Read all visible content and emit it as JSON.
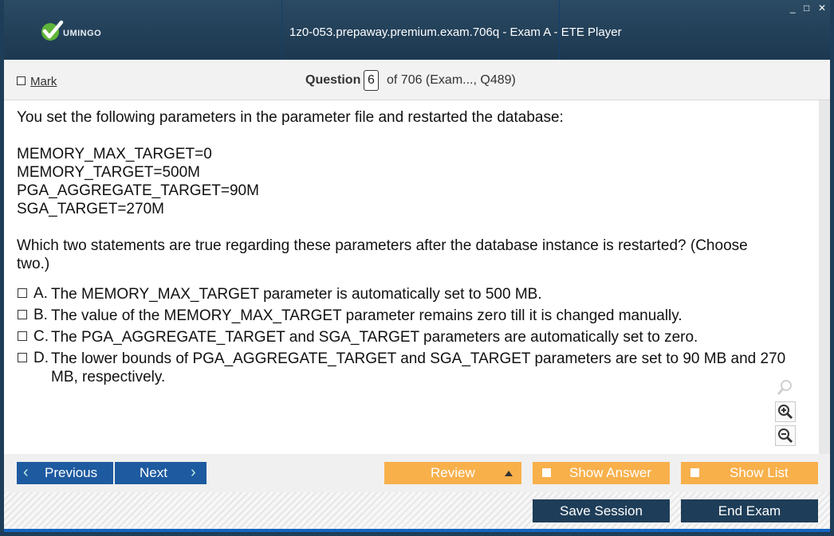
{
  "window": {
    "title": "1z0-053.prepaway.premium.exam.706q - Exam A - ETE Player",
    "logo_text": "UMINGO",
    "controls": {
      "minimize": "_",
      "maximize": "□",
      "close": "✕"
    }
  },
  "question_header": {
    "mark_label": "Mark",
    "question_label": "Question",
    "question_number": "6",
    "of_text": "of 706 (Exam..., Q489)"
  },
  "question": {
    "intro": "You set the following parameters in the parameter file and restarted the database:",
    "parameters": [
      "MEMORY_MAX_TARGET=0",
      "MEMORY_TARGET=500M",
      "PGA_AGGREGATE_TARGET=90M",
      "SGA_TARGET=270M"
    ],
    "prompt_line1": "Which two statements are true regarding these parameters after the database instance is restarted? (Choose",
    "prompt_line2": "two.)",
    "options": [
      {
        "letter": "A.",
        "text": "The MEMORY_MAX_TARGET parameter is automatically set to 500 MB."
      },
      {
        "letter": "B.",
        "text": "The value of the MEMORY_MAX_TARGET parameter remains zero till it is changed manually."
      },
      {
        "letter": "C.",
        "text": "The PGA_AGGREGATE_TARGET and SGA_TARGET parameters are automatically set to zero."
      },
      {
        "letter": "D.",
        "text": "The lower bounds of PGA_AGGREGATE_TARGET and SGA_TARGET parameters are set to 90 MB and 270 MB, respectively."
      }
    ]
  },
  "zoom_tools": [
    "magnifier-icon",
    "zoom-in-icon",
    "zoom-out-icon"
  ],
  "toolbar": {
    "previous_label": "Previous",
    "next_label": "Next",
    "review_label": "Review",
    "show_answer_label": "Show Answer",
    "show_list_label": "Show List"
  },
  "footer": {
    "save_session_label": "Save Session",
    "end_exam_label": "End Exam"
  },
  "colors": {
    "title_bg": "#1c3850",
    "nav_blue": "#1d5aa0",
    "orange": "#f8b04b",
    "dark_button": "#1e3d58",
    "accent_line": "#1565c0"
  }
}
